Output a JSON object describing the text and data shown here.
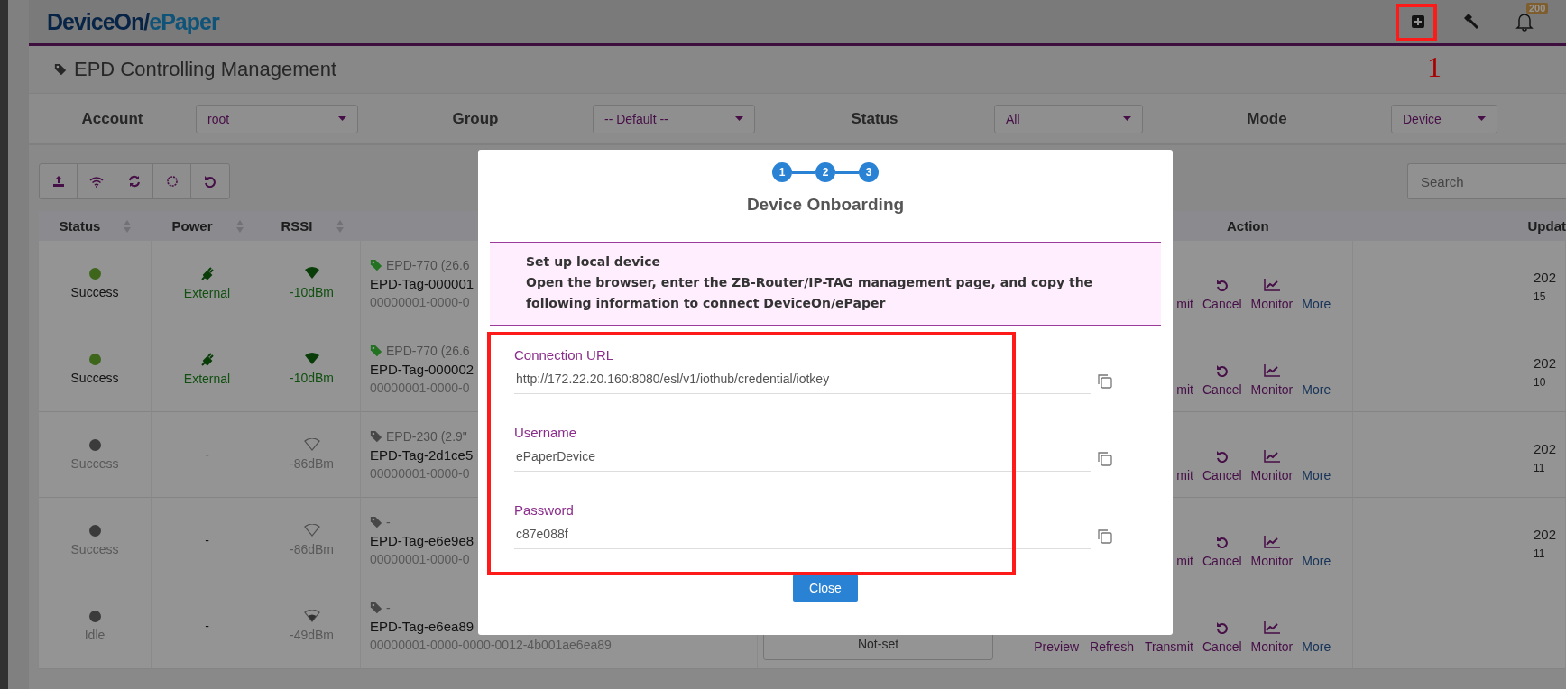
{
  "header": {
    "logo": {
      "primary": "DeviceOn/",
      "secondary": "ePaper"
    },
    "notification_badge": "200"
  },
  "annotation": {
    "label": "1"
  },
  "page_title": "EPD Controlling Management",
  "filters": [
    {
      "label": "Account",
      "value": "root"
    },
    {
      "label": "Group",
      "value": "-- Default --"
    },
    {
      "label": "Status",
      "value": "All"
    },
    {
      "label": "Mode",
      "value": "Device"
    }
  ],
  "search": {
    "placeholder": "Search"
  },
  "table": {
    "columns": [
      {
        "label": "Status",
        "sortable": true
      },
      {
        "label": "Power",
        "sortable": true
      },
      {
        "label": "RSSI",
        "sortable": true
      },
      {
        "label": "Action",
        "sortable": false
      },
      {
        "label": "Updat",
        "sortable": false
      }
    ],
    "rows": [
      {
        "status": "Success",
        "online": true,
        "external_power": true,
        "power": "External",
        "signal_strong": true,
        "signal_partial": false,
        "rssi": "-10dBm",
        "model": "EPD-770 (26.6",
        "name": "EPD-Tag-000001",
        "id": "00000001-0000-0",
        "links": [
          "mit"
        ],
        "cancel": "Cancel",
        "monitor": "Monitor",
        "more": "More",
        "updated": [
          "202",
          "15"
        ]
      },
      {
        "status": "Success",
        "online": true,
        "external_power": true,
        "power": "External",
        "signal_strong": true,
        "signal_partial": false,
        "rssi": "-10dBm",
        "model": "EPD-770 (26.6",
        "name": "EPD-Tag-000002",
        "id": "00000001-0000-0",
        "links": [
          "mit"
        ],
        "cancel": "Cancel",
        "monitor": "Monitor",
        "more": "More",
        "updated": [
          "202",
          "10"
        ]
      },
      {
        "status": "Success",
        "online": false,
        "external_power": false,
        "power": "-",
        "signal_strong": false,
        "signal_partial": false,
        "rssi": "-86dBm",
        "model": "EPD-230 (2.9\"",
        "name": "EPD-Tag-2d1ce5",
        "id": "00000001-0000-0",
        "links": [
          "mit"
        ],
        "cancel": "Cancel",
        "monitor": "Monitor",
        "more": "More",
        "updated": [
          "202",
          "11"
        ]
      },
      {
        "status": "Success",
        "online": false,
        "external_power": false,
        "power": "-",
        "signal_strong": false,
        "signal_partial": false,
        "rssi": "-86dBm",
        "model": "-",
        "name": "EPD-Tag-e6e9e8",
        "id": "00000001-0000-0",
        "links": [
          "mit"
        ],
        "cancel": "Cancel",
        "monitor": "Monitor",
        "more": "More",
        "updated": [
          "202",
          "11"
        ]
      },
      {
        "status": "Idle",
        "online": false,
        "external_power": false,
        "power": "-",
        "signal_strong": false,
        "signal_partial": true,
        "rssi": "-49dBm",
        "model": "-",
        "name": "EPD-Tag-e6ea89",
        "id": "00000001-0000-0000-0012-4b001ae6ea89",
        "config": "Not-set",
        "links": [
          "Preview",
          "Refresh",
          "Transmit"
        ],
        "cancel": "Cancel",
        "monitor": "Monitor",
        "more": "More"
      }
    ]
  },
  "modal": {
    "steps": [
      "1",
      "2",
      "3"
    ],
    "title": "Device Onboarding",
    "info": {
      "heading": "Set up local device",
      "text": "Open the browser, enter the ZB-Router/IP-TAG management page, and copy the following information to connect DeviceOn/ePaper"
    },
    "fields": [
      {
        "label": "Connection URL",
        "value": "http://172.22.20.160:8080/esl/v1/iothub/credential/iotkey"
      },
      {
        "label": "Username",
        "value": "ePaperDevice"
      },
      {
        "label": "Password",
        "value": "c87e088f"
      }
    ],
    "button": "Close"
  }
}
